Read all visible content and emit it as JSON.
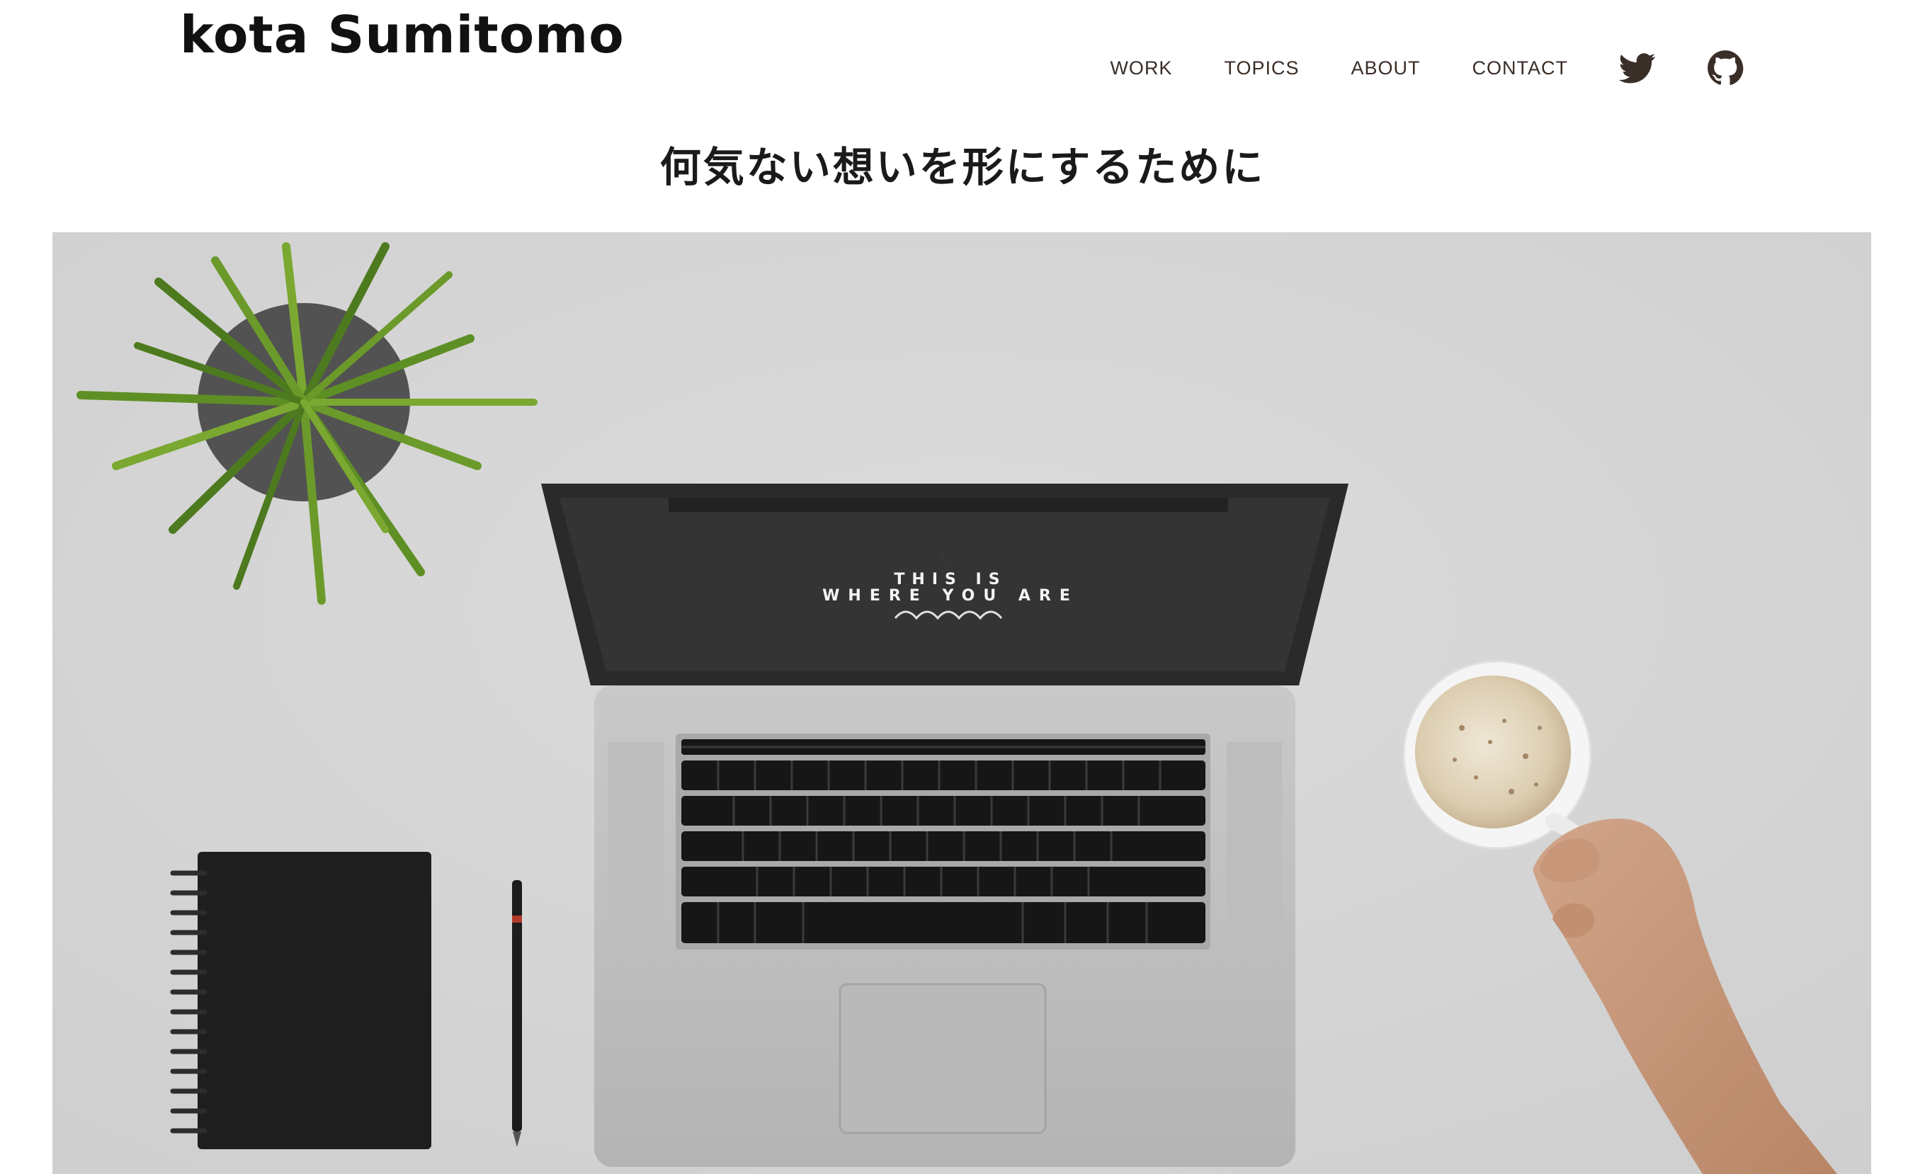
{
  "site": {
    "title": "kota Sumitomo"
  },
  "nav": {
    "items": [
      {
        "label": "WORK"
      },
      {
        "label": "TOPICS"
      },
      {
        "label": "ABOUT"
      },
      {
        "label": "CONTACT"
      }
    ],
    "social": [
      {
        "icon": "twitter-icon"
      },
      {
        "icon": "github-icon"
      }
    ]
  },
  "hero": {
    "tagline": "何気ない想いを形にするために",
    "image_text": {
      "line1": "THIS IS",
      "line2": "WHERE YOU ARE"
    }
  },
  "colors": {
    "nav_text": "#3a2e28",
    "title_text": "#111111",
    "hero_background": "#d9d9d9"
  }
}
